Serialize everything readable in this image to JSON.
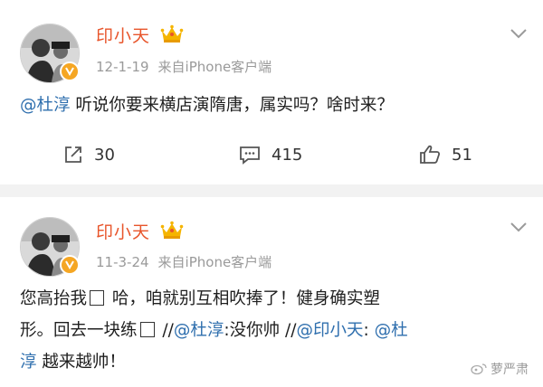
{
  "posts": [
    {
      "username": "印小天",
      "date": "12-1-19",
      "source": "来自iPhone客户端",
      "mention": "@杜淳",
      "text": " 听说你要来横店演隋唐，属实吗？啥时来？",
      "actions": {
        "repost": "30",
        "comment": "415",
        "like": "51"
      }
    },
    {
      "username": "印小天",
      "date": "11-3-24",
      "source": "来自iPhone客户端",
      "line1_a": "您高抬我",
      "line1_b": " 哈，咱就别互相吹捧了！健身确实塑",
      "line2_a": "形。回去一块练",
      "line2_sep1": " //",
      "line2_m1": "@杜淳",
      "line2_b": ":没你帅 //",
      "line2_m2": "@印小天",
      "line2_c": ": ",
      "line2_m3": "@杜",
      "line3_m": "淳",
      "line3_b": " 越来越帅！"
    }
  ],
  "watermark": "萝严肃",
  "icons": [
    "avatar",
    "verified-badge-icon",
    "crown-icon",
    "chevron-down-icon",
    "repost-icon",
    "comment-icon",
    "like-icon",
    "watermark-logo-icon"
  ],
  "colors": {
    "username": "#e8552b",
    "mention": "#2f6fae",
    "meta": "#9a9a9a",
    "badge": "#f5a623",
    "separator": "#f2f2f2"
  }
}
